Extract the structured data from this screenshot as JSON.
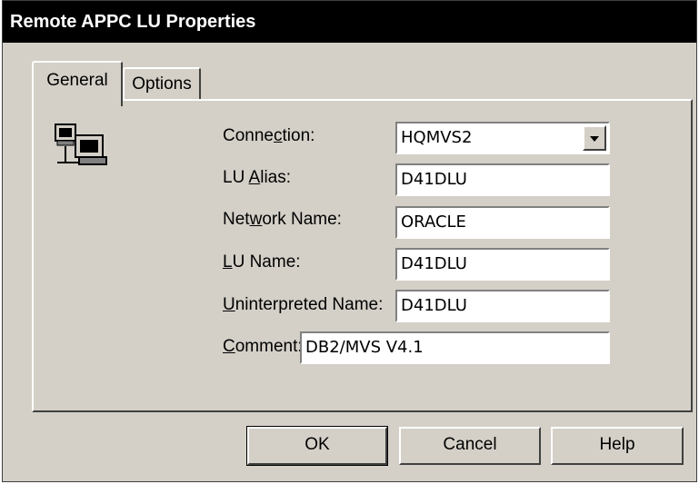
{
  "window": {
    "title": "Remote APPC LU Properties"
  },
  "tabs": [
    {
      "label": "General",
      "active": true
    },
    {
      "label": "Options",
      "active": false
    }
  ],
  "icon": {
    "name": "computer-network-icon"
  },
  "form": {
    "connection_label_pre": "Conne",
    "connection_label_key": "c",
    "connection_label_post": "tion:",
    "connection_value": "HQMVS2",
    "lu_alias_label_pre": "LU ",
    "lu_alias_label_key": "A",
    "lu_alias_label_post": "lias:",
    "lu_alias_value": "D41DLU",
    "network_name_label_pre": "Net",
    "network_name_label_key": "w",
    "network_name_label_post": "ork Name:",
    "network_name_value": "ORACLE",
    "lu_name_label_pre": "",
    "lu_name_label_key": "L",
    "lu_name_label_post": "U Name:",
    "lu_name_value": "D41DLU",
    "uninterpreted_label_pre": "",
    "uninterpreted_label_key": "U",
    "uninterpreted_label_post": "ninterpreted Name:",
    "uninterpreted_value": "D41DLU",
    "comment_label_pre": "",
    "comment_label_key": "C",
    "comment_label_post": "omment:",
    "comment_value": "DB2/MVS V4.1"
  },
  "buttons": {
    "ok": "OK",
    "cancel": "Cancel",
    "help": "Help"
  }
}
